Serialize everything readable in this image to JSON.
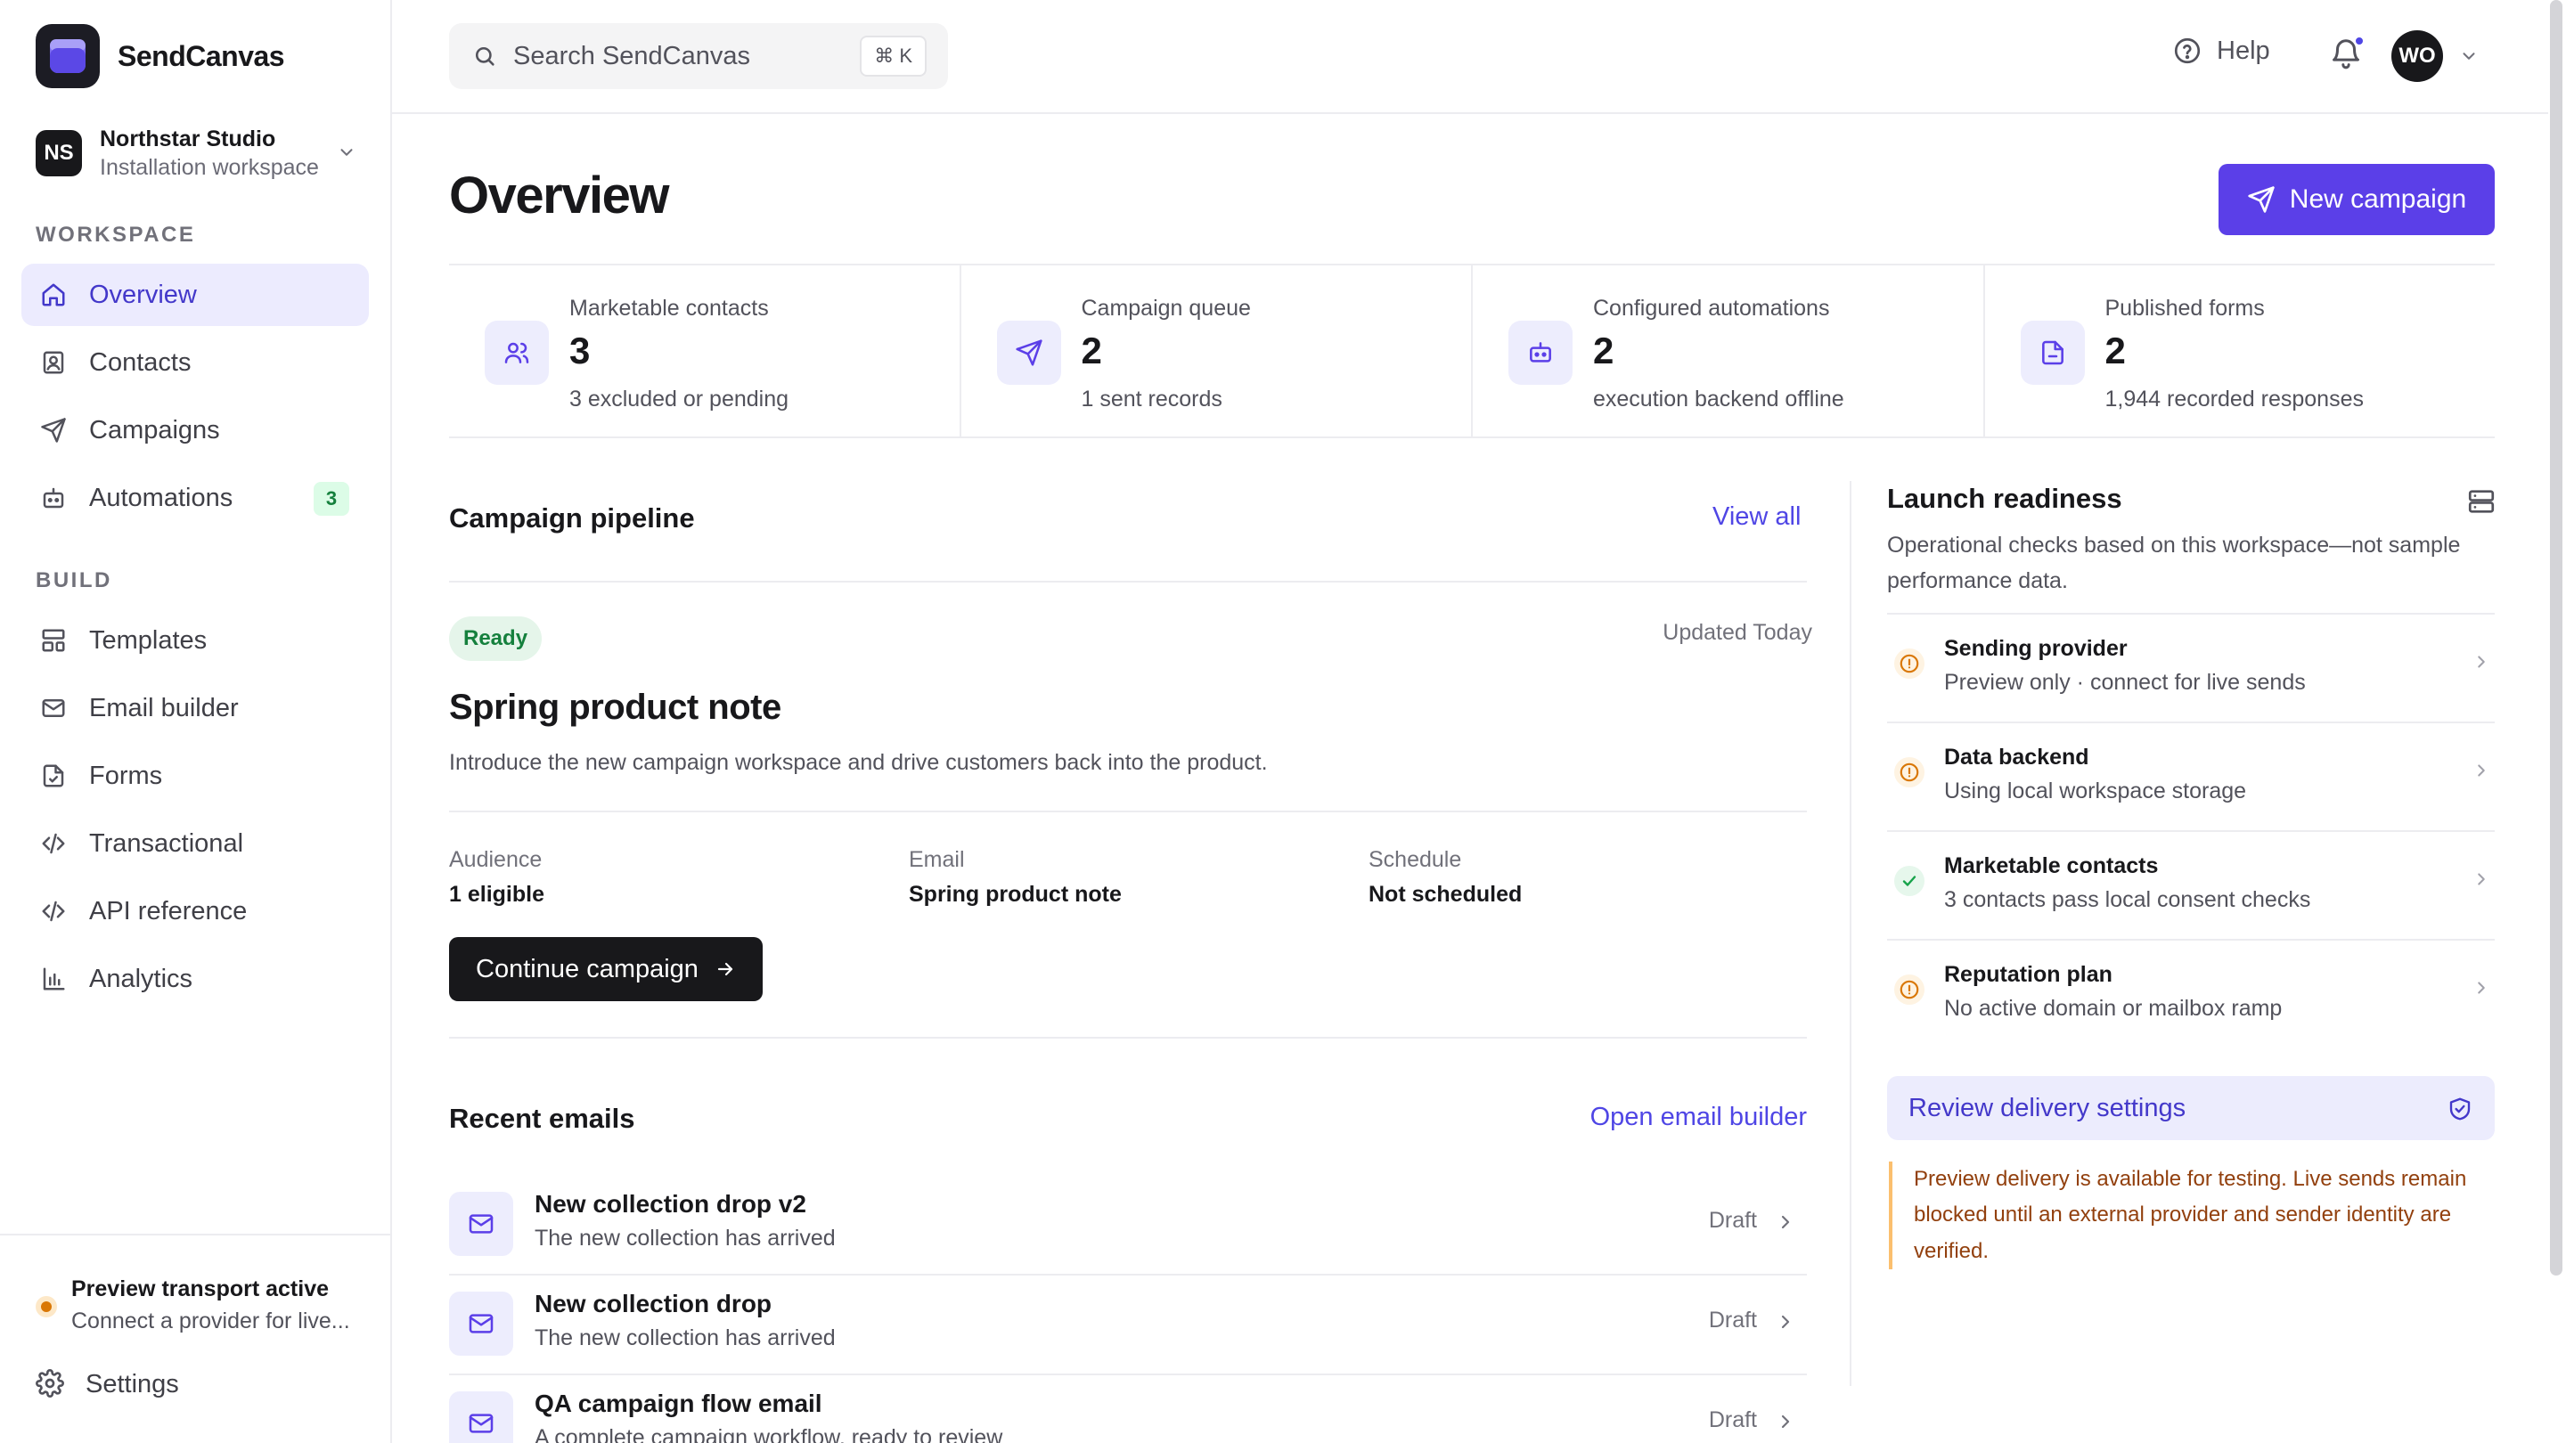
{
  "app": {
    "name": "SendCanvas"
  },
  "workspace": {
    "initials": "NS",
    "name": "Northstar Studio",
    "subtitle": "Installation workspace"
  },
  "nav": {
    "workspace_label": "WORKSPACE",
    "build_label": "BUILD",
    "workspace_items": [
      {
        "label": "Overview",
        "icon": "home-icon",
        "active": true
      },
      {
        "label": "Contacts",
        "icon": "contacts-icon"
      },
      {
        "label": "Campaigns",
        "icon": "send-icon"
      },
      {
        "label": "Automations",
        "icon": "robot-icon",
        "badge": "3"
      }
    ],
    "build_items": [
      {
        "label": "Templates",
        "icon": "layout-icon"
      },
      {
        "label": "Email builder",
        "icon": "mail-icon"
      },
      {
        "label": "Forms",
        "icon": "form-icon"
      },
      {
        "label": "Transactional",
        "icon": "code-icon"
      },
      {
        "label": "API reference",
        "icon": "code-icon"
      },
      {
        "label": "Analytics",
        "icon": "bar-chart-icon"
      }
    ]
  },
  "transport": {
    "title": "Preview transport active",
    "subtitle": "Connect a provider for live..."
  },
  "settings_label": "Settings",
  "topbar": {
    "search_placeholder": "Search SendCanvas",
    "shortcut": "⌘ K",
    "help_label": "Help",
    "user_initials": "WO"
  },
  "page": {
    "title": "Overview",
    "new_campaign_label": "New campaign"
  },
  "stats": [
    {
      "label": "Marketable contacts",
      "value": "3",
      "sub": "3 excluded or pending",
      "icon": "users-icon"
    },
    {
      "label": "Campaign queue",
      "value": "2",
      "sub": "1 sent records",
      "icon": "send-icon"
    },
    {
      "label": "Configured automations",
      "value": "2",
      "sub": "execution backend offline",
      "icon": "robot-icon"
    },
    {
      "label": "Published forms",
      "value": "2",
      "sub": "1,944 recorded responses",
      "icon": "form-icon"
    }
  ],
  "pipeline": {
    "title": "Campaign pipeline",
    "view_all": "View all",
    "badge": "Ready",
    "updated": "Updated Today",
    "campaign_title": "Spring product note",
    "campaign_desc": "Introduce the new campaign workspace and drive customers back into the product.",
    "meta": [
      {
        "label": "Audience",
        "value": "1 eligible"
      },
      {
        "label": "Email",
        "value": "Spring product note"
      },
      {
        "label": "Schedule",
        "value": "Not scheduled"
      }
    ],
    "continue_label": "Continue campaign"
  },
  "recent": {
    "title": "Recent emails",
    "link": "Open email builder",
    "emails": [
      {
        "title": "New collection drop v2",
        "sub": "The new collection has arrived",
        "status": "Draft"
      },
      {
        "title": "New collection drop",
        "sub": "The new collection has arrived",
        "status": "Draft"
      },
      {
        "title": "QA campaign flow email",
        "sub": "A complete campaign workflow, ready to review",
        "status": "Draft"
      }
    ]
  },
  "readiness": {
    "title": "Launch readiness",
    "desc": "Operational checks based on this workspace—not sample performance data.",
    "checks": [
      {
        "title": "Sending provider",
        "sub": "Preview only · connect for live sends",
        "state": "warning"
      },
      {
        "title": "Data backend",
        "sub": "Using local workspace storage",
        "state": "warning"
      },
      {
        "title": "Marketable contacts",
        "sub": "3 contacts pass local consent checks",
        "state": "ok"
      },
      {
        "title": "Reputation plan",
        "sub": "No active domain or mailbox ramp",
        "state": "warning"
      }
    ],
    "review_label": "Review delivery settings",
    "notice": "Preview delivery is available for testing. Live sends remain blocked until an external provider and sender identity are verified."
  },
  "colors": {
    "accent": "#5b3fe8",
    "warning": "#d97706",
    "success": "#16a34a",
    "dark": "#18181b"
  }
}
